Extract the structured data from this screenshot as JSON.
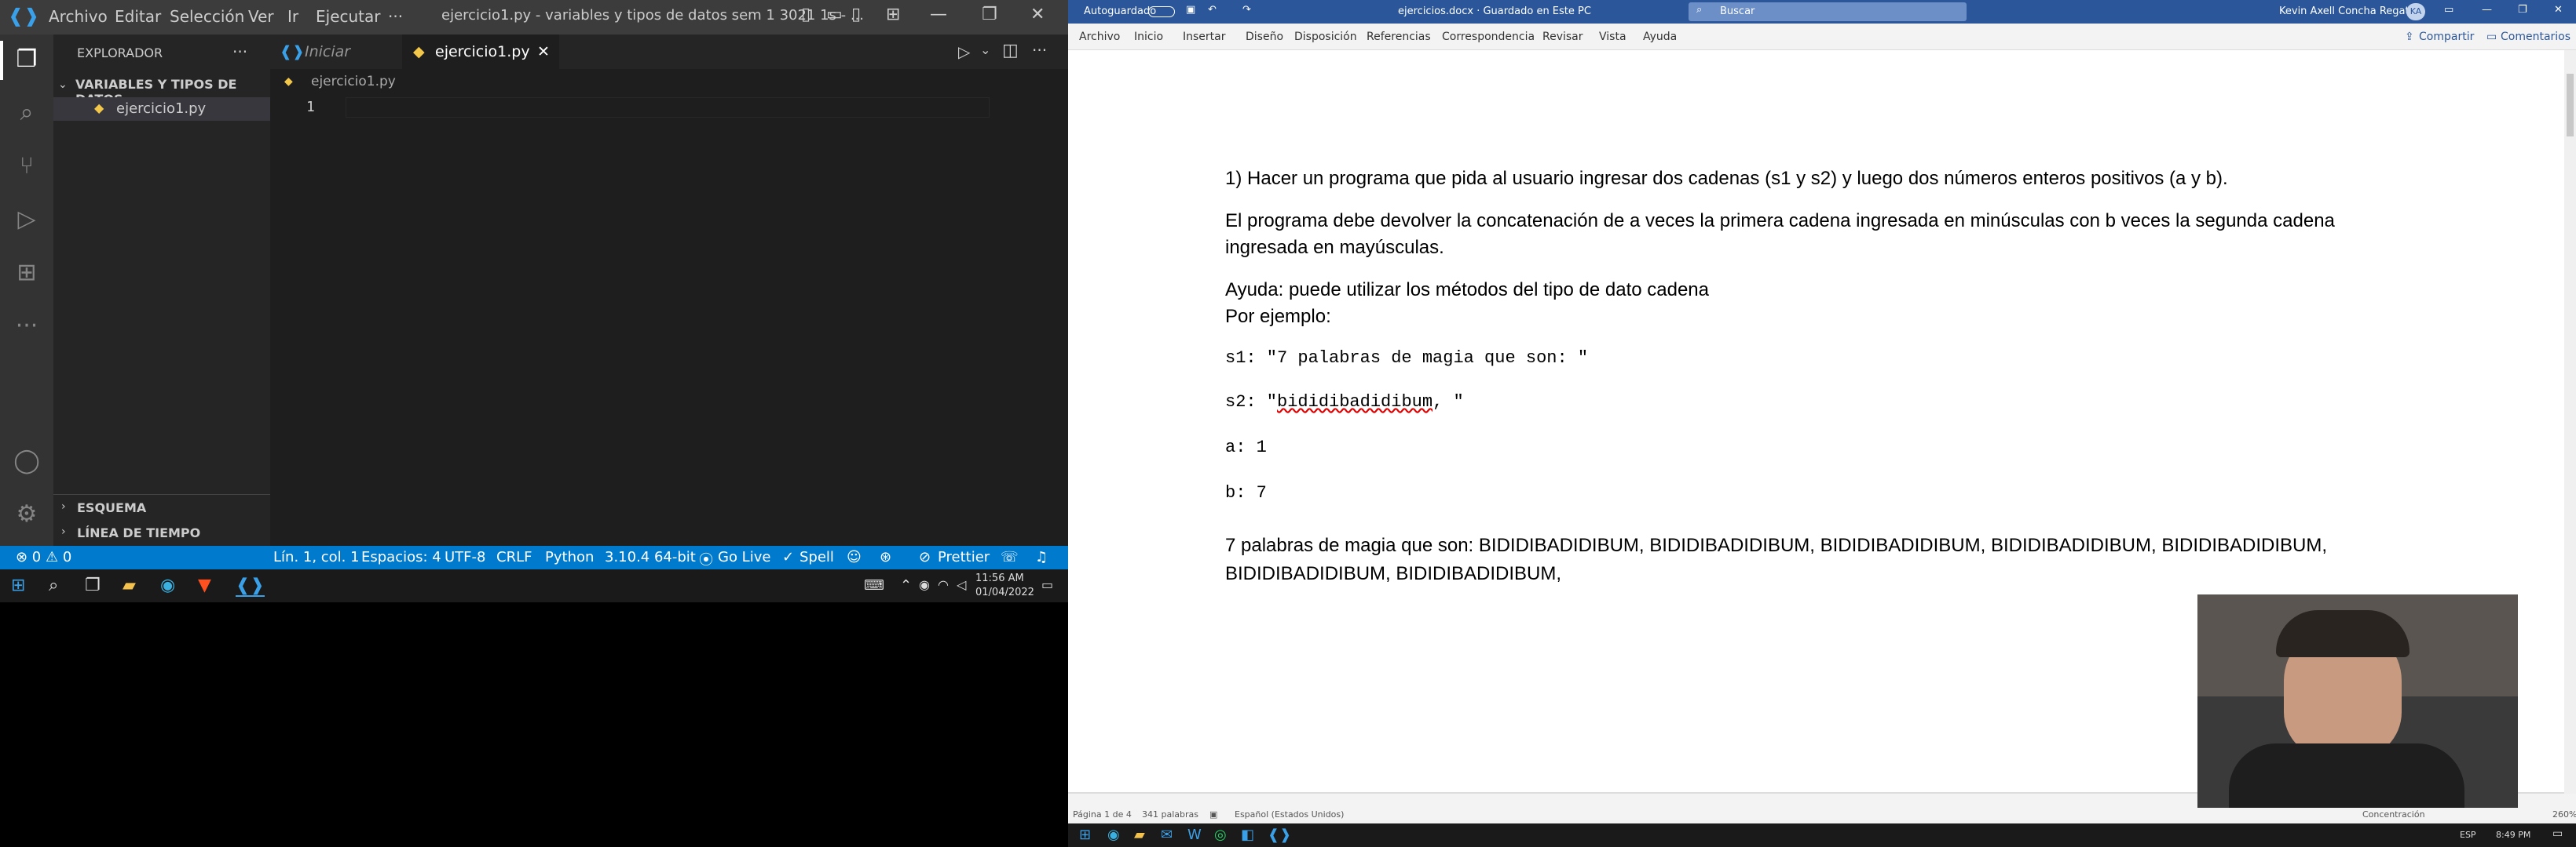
{
  "vscode": {
    "menu": [
      "Archivo",
      "Editar",
      "Selección",
      "Ver",
      "Ir",
      "Ejecutar",
      "···"
    ],
    "window_title": "ejercicio1.py - variables y tipos de datos sem 1 3021 1s - ...",
    "explorer_title": "EXPLORADOR",
    "folder_name": "VARIABLES Y TIPOS DE DATOS...",
    "file_name": "ejercicio1.py",
    "outline_section": "ESQUEMA",
    "timeline_section": "LÍNEA DE TIEMPO",
    "tabs": [
      {
        "label": "Iniciar"
      },
      {
        "label": "ejercicio1.py"
      }
    ],
    "breadcrumb": "ejercicio1.py",
    "line_number": "1",
    "status": {
      "problems": "⊗ 0 ⚠ 0",
      "position": "Lín. 1, col. 1",
      "spaces": "Espacios: 4",
      "encoding": "UTF-8",
      "eol": "CRLF",
      "language": "Python",
      "interpreter": "3.10.4 64-bit",
      "golive": "Go Live",
      "spell": "Spell",
      "prettier": "Prettier"
    },
    "clock": {
      "time": "11:56 AM",
      "date": "01/04/2022"
    }
  },
  "word": {
    "autosave": "Autoguardado",
    "doc_title": "ejercicios.docx · Guardado en Este PC",
    "search_placeholder": "Buscar",
    "user": "Kevin Axell Concha Regatto",
    "user_initials": "KA",
    "menu": [
      "Archivo",
      "Inicio",
      "Insertar",
      "Diseño",
      "Disposición",
      "Referencias",
      "Correspondencia",
      "Revisar",
      "Vista",
      "Ayuda"
    ],
    "share": "Compartir",
    "comments": "Comentarios",
    "paragraphs": {
      "p1": "1) Hacer un programa que pida al usuario ingresar dos cadenas (s1 y s2) y luego dos números enteros positivos (a y b).",
      "p2a": "El programa debe devolver la concatenación de a veces la primera cadena ingresada en minúsculas con b veces la segunda cadena",
      "p2b": "ingresada en mayúsculas.",
      "p3": "Ayuda: puede utilizar los métodos del tipo de dato cadena",
      "p4": "Por ejemplo:",
      "s1": "s1: \"7 palabras de magia que son: \"",
      "s2_prefix": "s2: \"",
      "s2_word": "bididibadidibum",
      "s2_suffix": ", \"",
      "a": "a: 1",
      "b": "b: 7",
      "out1": "7 palabras de magia que son: BIDIDIBADIDIBUM, BIDIDIBADIDIBUM, BIDIDIBADIDIBUM, BIDIDIBADIDIBUM, BIDIDIBADIDIBUM,",
      "out2": "BIDIDIBADIDIBUM, BIDIDIBADIDIBUM,"
    },
    "status": {
      "page": "Página 1 de 4",
      "words": "341 palabras",
      "language": "Español (Estados Unidos)",
      "focus": "Concentración",
      "zoom": "260%"
    },
    "clock": {
      "time": "8:49 PM",
      "lang": "ESP"
    }
  },
  "colors": {
    "vscode_status": "#007acc",
    "word_blue": "#2b579a"
  }
}
